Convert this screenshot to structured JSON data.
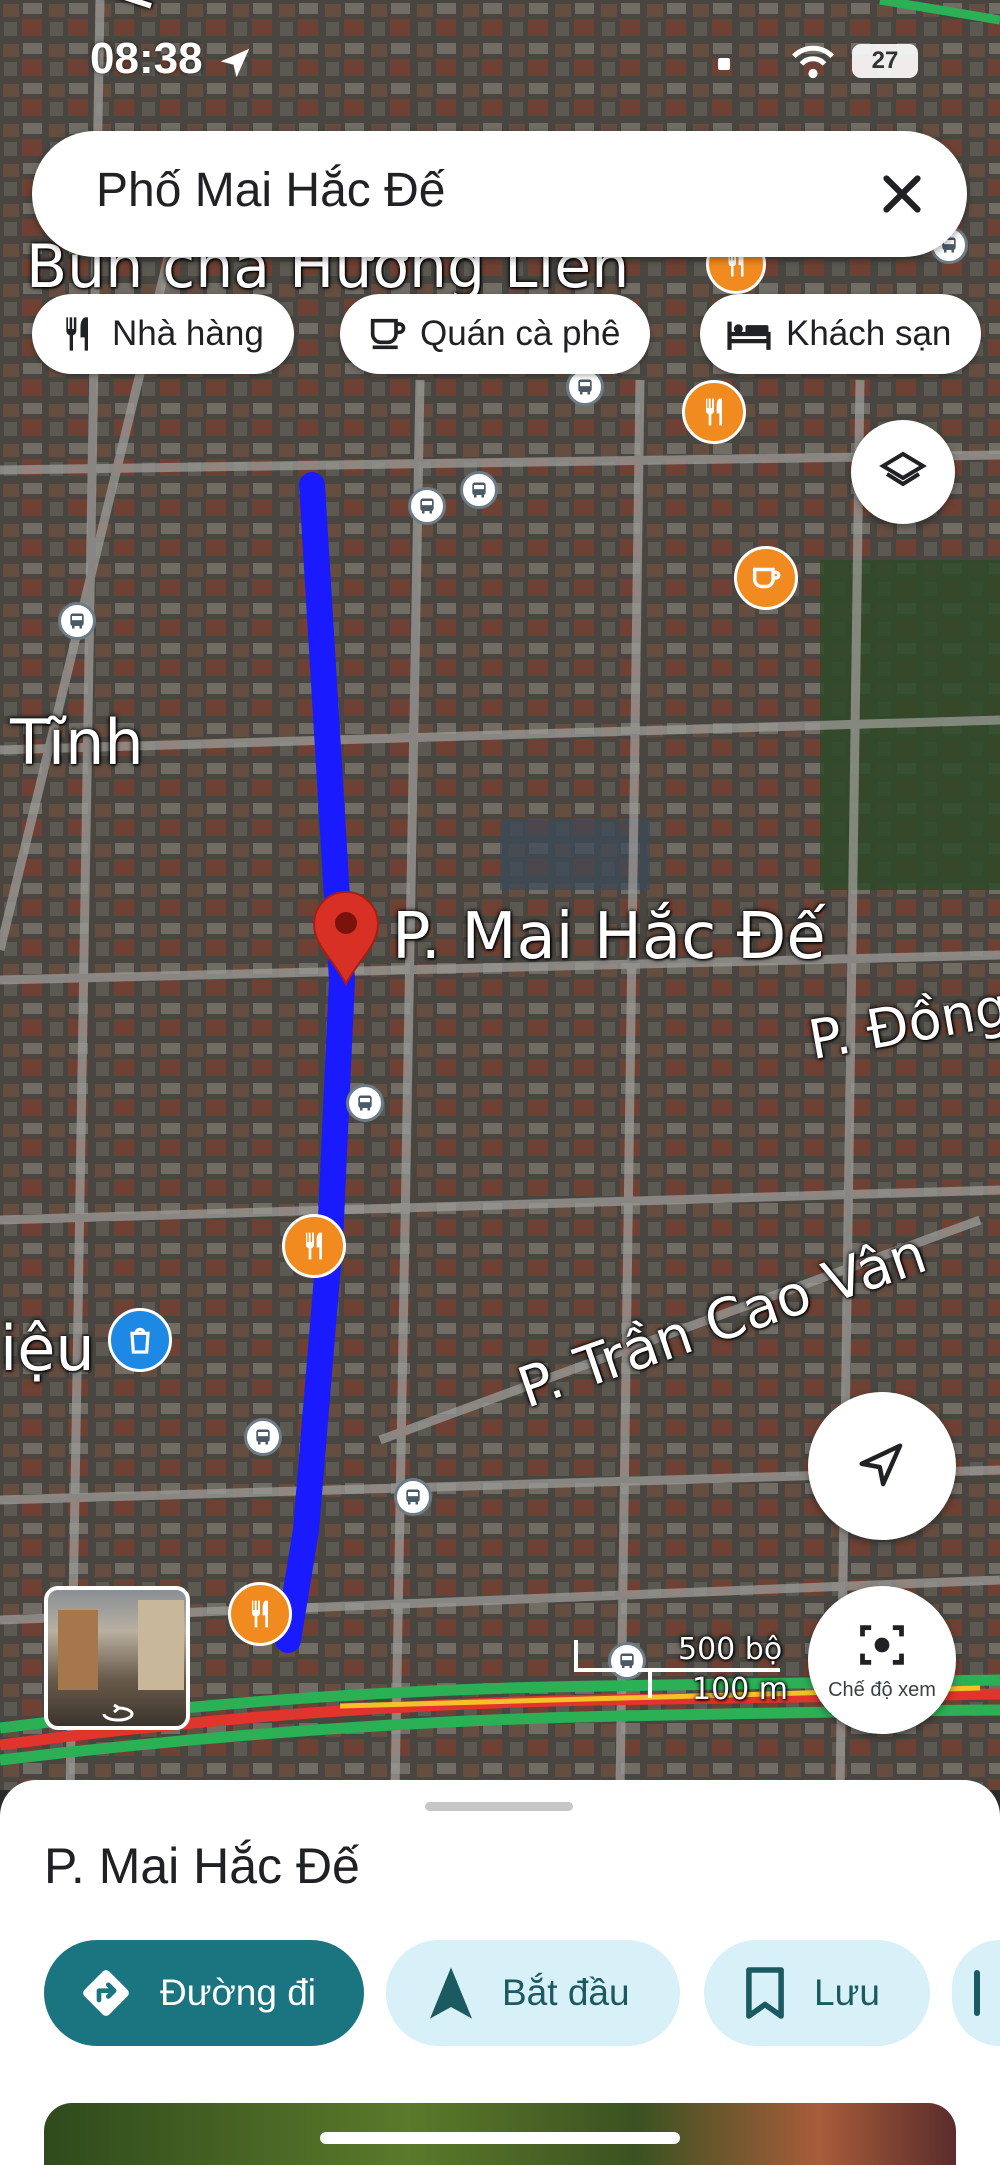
{
  "status_bar": {
    "time": "08:38",
    "battery": "27"
  },
  "search": {
    "query": "Phố Mai Hắc Đế"
  },
  "chips": [
    {
      "icon": "restaurant-icon",
      "label": "Nhà hàng"
    },
    {
      "icon": "coffee-icon",
      "label": "Quán cà phê"
    },
    {
      "icon": "hotel-icon",
      "label": "Khách sạn"
    }
  ],
  "map": {
    "labels": {
      "top_street": "P. Bà",
      "restaurant_name": "Bún chả Hương Liên",
      "tinh": "Tĩnh",
      "selected_street": "P. Mai Hắc Đế",
      "dong": "P. Đồng",
      "tran_cao_van": "P. Trần Cao Vân",
      "ieu": "iệu"
    },
    "scale": {
      "imperial": "500 bộ",
      "metric": "100 m"
    }
  },
  "buttons": {
    "view_mode": "Chế độ xem"
  },
  "sheet": {
    "title": "P. Mai Hắc Đế",
    "actions": [
      {
        "icon": "directions-icon",
        "label": "Đường đi"
      },
      {
        "icon": "navigation-icon",
        "label": "Bắt đầu"
      },
      {
        "icon": "bookmark-icon",
        "label": "Lưu"
      }
    ]
  },
  "colors": {
    "route": "#1a1aff",
    "pin_red": "#d93025",
    "poi_orange": "#f28b1f",
    "primary_teal": "#1a7580",
    "secondary_bg": "#d8f0f8"
  }
}
